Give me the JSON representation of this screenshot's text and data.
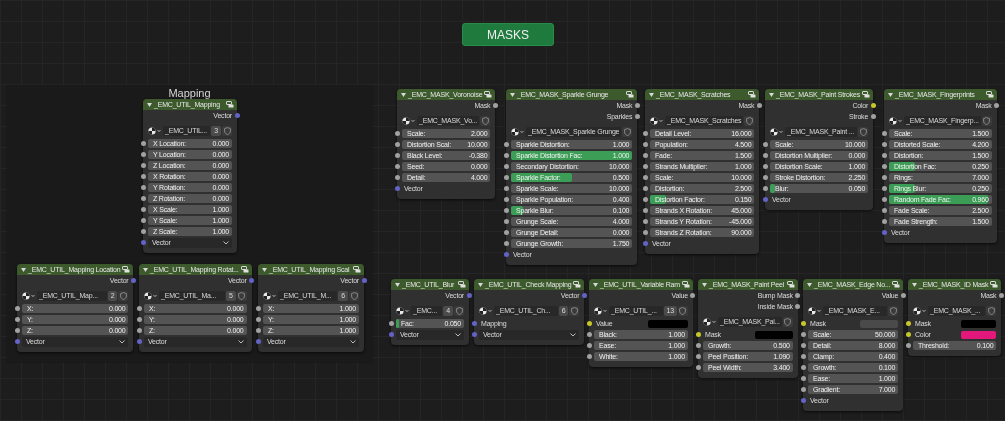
{
  "header_button": {
    "label": "MASKS"
  },
  "frames": [
    {
      "label": "Mapping",
      "nodes": [
        {
          "title": "_EMC_UTIL_Mapping",
          "outputs": [
            {
              "label": "Vector",
              "color": "#6363c7"
            }
          ],
          "datablock": {
            "name": "_EMC_UTIL...",
            "users": "3"
          },
          "inputs": [
            {
              "kind": "field",
              "label": "X Location:",
              "value": "0.000",
              "color": "#a1a1a1"
            },
            {
              "kind": "field",
              "label": "Y Location:",
              "value": "0.000",
              "color": "#a1a1a1"
            },
            {
              "kind": "field",
              "label": "Z Location:",
              "value": "0.000",
              "color": "#a1a1a1"
            },
            {
              "kind": "field",
              "label": "X Rotation:",
              "value": "0.000",
              "color": "#a1a1a1"
            },
            {
              "kind": "field",
              "label": "Y Rotation:",
              "value": "0.000",
              "color": "#a1a1a1"
            },
            {
              "kind": "field",
              "label": "Z Rotation:",
              "value": "0.000",
              "color": "#a1a1a1"
            },
            {
              "kind": "field",
              "label": "X Scale:",
              "value": "1.000",
              "color": "#a1a1a1"
            },
            {
              "kind": "field",
              "label": "Y Scale:",
              "value": "1.000",
              "color": "#a1a1a1"
            },
            {
              "kind": "field",
              "label": "Z Scale:",
              "value": "1.000",
              "color": "#a1a1a1"
            },
            {
              "kind": "dropdown",
              "label": "Vector",
              "color": "#6363c7"
            }
          ]
        },
        {
          "title": "_EMC_UTIL_Mapping Location",
          "outputs": [
            {
              "label": "Vector",
              "color": "#6363c7"
            }
          ],
          "datablock": {
            "name": "_EMC_UTIL_Map...",
            "users": "2"
          },
          "inputs": [
            {
              "kind": "field",
              "label": "X:",
              "value": "0.000",
              "color": "#a1a1a1"
            },
            {
              "kind": "field",
              "label": "Y:",
              "value": "0.000",
              "color": "#a1a1a1"
            },
            {
              "kind": "field",
              "label": "Z:",
              "value": "0.000",
              "color": "#a1a1a1"
            },
            {
              "kind": "dropdown",
              "label": "Vector",
              "color": "#6363c7"
            }
          ]
        },
        {
          "title": "_EMC_UTIL_Mapping Rotat...",
          "outputs": [
            {
              "label": "Vector",
              "color": "#6363c7"
            }
          ],
          "datablock": {
            "name": "_EMC_UTIL_Ma...",
            "users": "5"
          },
          "inputs": [
            {
              "kind": "field",
              "label": "X:",
              "value": "0.000",
              "color": "#a1a1a1"
            },
            {
              "kind": "field",
              "label": "Y:",
              "value": "0.000",
              "color": "#a1a1a1"
            },
            {
              "kind": "field",
              "label": "Z:",
              "value": "0.000",
              "color": "#a1a1a1"
            },
            {
              "kind": "dropdown",
              "label": "Vector",
              "color": "#6363c7"
            }
          ]
        },
        {
          "title": "_EMC_UTIL_Mapping Scal",
          "outputs": [
            {
              "label": "Vector",
              "color": "#6363c7"
            }
          ],
          "datablock": {
            "name": "_EMC_UTIL_M...",
            "users": "6"
          },
          "inputs": [
            {
              "kind": "field",
              "label": "X:",
              "value": "1.000",
              "color": "#a1a1a1"
            },
            {
              "kind": "field",
              "label": "Y:",
              "value": "1.000",
              "color": "#a1a1a1"
            },
            {
              "kind": "field",
              "label": "Z:",
              "value": "1.000",
              "color": "#a1a1a1"
            },
            {
              "kind": "dropdown",
              "label": "Vector",
              "color": "#6363c7"
            }
          ]
        }
      ]
    }
  ],
  "nodes": [
    {
      "title": "_EMC_MASK_Voronoise",
      "outputs": [
        {
          "label": "Mask",
          "color": "#a1a1a1"
        }
      ],
      "datablock": {
        "name": "_EMC_MASK_Vo..."
      },
      "inputs": [
        {
          "kind": "field",
          "label": "Scale:",
          "value": "2.000",
          "color": "#a1a1a1"
        },
        {
          "kind": "field",
          "label": "Distortion Scal:",
          "value": "10.000",
          "color": "#a1a1a1"
        },
        {
          "kind": "field",
          "label": "Black Level:",
          "value": "-0.380",
          "color": "#a1a1a1"
        },
        {
          "kind": "field",
          "label": "Seed:",
          "value": "0.000",
          "color": "#a1a1a1"
        },
        {
          "kind": "field",
          "label": "Detail:",
          "value": "4.000",
          "color": "#a1a1a1"
        },
        {
          "kind": "socket",
          "label": "Vector",
          "color": "#6363c7"
        }
      ]
    },
    {
      "title": "_EMC_MASK_Sparkle Grunge",
      "outputs": [
        {
          "label": "Mask",
          "color": "#a1a1a1"
        },
        {
          "label": "Sparkles",
          "color": "#a1a1a1"
        }
      ],
      "datablock": {
        "name": "_EMC_MASK_Sparkle Grunge"
      },
      "inputs": [
        {
          "kind": "field",
          "label": "Sparkle Distortion:",
          "value": "1.000",
          "color": "#a1a1a1"
        },
        {
          "kind": "slider",
          "label": "Sparkle Distortion Fac:",
          "value": "1.000",
          "level": 1,
          "color": "#a1a1a1"
        },
        {
          "kind": "field",
          "label": "Secondary Distortion:",
          "value": "10.000",
          "color": "#a1a1a1"
        },
        {
          "kind": "slider",
          "label": "Sparkle Factor:",
          "value": "0.500",
          "level": 0.5,
          "color": "#a1a1a1"
        },
        {
          "kind": "field",
          "label": "Sparkle Scale:",
          "value": "10.000",
          "color": "#a1a1a1"
        },
        {
          "kind": "field",
          "label": "Sparkle Population:",
          "value": "0.400",
          "color": "#a1a1a1"
        },
        {
          "kind": "slider",
          "label": "Sparkle Blur:",
          "value": "0.100",
          "level": 0.1,
          "color": "#a1a1a1"
        },
        {
          "kind": "field",
          "label": "Grunge Scale:",
          "value": "4.000",
          "color": "#a1a1a1"
        },
        {
          "kind": "field",
          "label": "Grunge Detail:",
          "value": "0.000",
          "color": "#a1a1a1"
        },
        {
          "kind": "field",
          "label": "Grunge Growth:",
          "value": "1.750",
          "color": "#a1a1a1"
        },
        {
          "kind": "socket",
          "label": "Vector",
          "color": "#6363c7"
        }
      ]
    },
    {
      "title": "_EMC_MASK_Scratches",
      "outputs": [
        {
          "label": "Mask",
          "color": "#a1a1a1"
        }
      ],
      "datablock": {
        "name": "_EMC_MASK_Scratches"
      },
      "inputs": [
        {
          "kind": "field",
          "label": "Detail Level:",
          "value": "16.000",
          "color": "#a1a1a1"
        },
        {
          "kind": "field",
          "label": "Population:",
          "value": "4.500",
          "color": "#a1a1a1"
        },
        {
          "kind": "field",
          "label": "Fade:",
          "value": "1.500",
          "color": "#a1a1a1"
        },
        {
          "kind": "field",
          "label": "Strands Multiplier:",
          "value": "1.000",
          "color": "#a1a1a1"
        },
        {
          "kind": "field",
          "label": "Scale:",
          "value": "10.000",
          "color": "#a1a1a1"
        },
        {
          "kind": "field",
          "label": "Distortion:",
          "value": "2.500",
          "color": "#a1a1a1"
        },
        {
          "kind": "slider",
          "label": "Distortion Factor:",
          "value": "0.150",
          "level": 0.15,
          "color": "#a1a1a1"
        },
        {
          "kind": "field",
          "label": "Strands X Rotation:",
          "value": "45.000",
          "color": "#a1a1a1"
        },
        {
          "kind": "field",
          "label": "Strands Y Rotation:",
          "value": "-45.000",
          "color": "#a1a1a1"
        },
        {
          "kind": "field",
          "label": "Strands Z Rotation:",
          "value": "90.000",
          "color": "#a1a1a1"
        },
        {
          "kind": "socket",
          "label": "Vector",
          "color": "#6363c7"
        }
      ]
    },
    {
      "title": "_EMC_MASK_Paint Strokes",
      "outputs": [
        {
          "label": "Color",
          "color": "#c7c729"
        },
        {
          "label": "Stroke",
          "color": "#a1a1a1"
        }
      ],
      "datablock": {
        "name": "_EMC_MASK_Paint ..."
      },
      "inputs": [
        {
          "kind": "field",
          "label": "Scale:",
          "value": "10.000",
          "color": "#a1a1a1"
        },
        {
          "kind": "field",
          "label": "Distortion Multiplier:",
          "value": "0.000",
          "color": "#a1a1a1"
        },
        {
          "kind": "field",
          "label": "Distortion Scale:",
          "value": "1.000",
          "color": "#a1a1a1"
        },
        {
          "kind": "field",
          "label": "Stroke Distortion:",
          "value": "2.250",
          "color": "#a1a1a1"
        },
        {
          "kind": "slider",
          "label": "Blur:",
          "value": "0.050",
          "level": 0.05,
          "color": "#a1a1a1"
        },
        {
          "kind": "socket",
          "label": "Vector",
          "color": "#6363c7"
        }
      ]
    },
    {
      "title": "_EMC_MASK_Fingerprints",
      "outputs": [
        {
          "label": "Mask",
          "color": "#a1a1a1"
        }
      ],
      "datablock": {
        "name": "_EMC_MASK_Fingerp..."
      },
      "inputs": [
        {
          "kind": "field",
          "label": "Scale:",
          "value": "1.500",
          "color": "#a1a1a1"
        },
        {
          "kind": "field",
          "label": "Distorted Scale:",
          "value": "4.200",
          "color": "#a1a1a1"
        },
        {
          "kind": "field",
          "label": "Distortion:",
          "value": "1.500",
          "color": "#a1a1a1"
        },
        {
          "kind": "slider",
          "label": "Distortion Fac:",
          "value": "0.250",
          "level": 0.25,
          "color": "#a1a1a1"
        },
        {
          "kind": "field",
          "label": "Rings:",
          "value": "7.000",
          "color": "#a1a1a1"
        },
        {
          "kind": "slider",
          "label": "Rings Blur:",
          "value": "0.250",
          "level": 0.25,
          "color": "#a1a1a1"
        },
        {
          "kind": "slider",
          "label": "Random Fade Fac:",
          "value": "0.960",
          "level": 0.96,
          "color": "#a1a1a1"
        },
        {
          "kind": "field",
          "label": "Fade Scale:",
          "value": "2.500",
          "color": "#a1a1a1"
        },
        {
          "kind": "field",
          "label": "Fade Strength:",
          "value": "1.500",
          "color": "#a1a1a1"
        },
        {
          "kind": "socket",
          "label": "Vector",
          "color": "#6363c7"
        }
      ]
    },
    {
      "title": "_EMC_UTIL_Blur",
      "outputs": [
        {
          "label": "Vector",
          "color": "#6363c7"
        }
      ],
      "datablock": {
        "name": "_EMC...",
        "users": "4"
      },
      "inputs": [
        {
          "kind": "slider",
          "label": "Fac:",
          "value": "0.050",
          "level": 0.05,
          "color": "#a1a1a1"
        },
        {
          "kind": "dropdown",
          "label": "Vector",
          "color": "#6363c7"
        }
      ]
    },
    {
      "title": "_EMC_UTIL_Check Mapping",
      "outputs": [
        {
          "label": "Vector",
          "color": "#6363c7"
        }
      ],
      "datablock": {
        "name": "_EMC_UTIL_Ch...",
        "users": "6"
      },
      "inputs": [
        {
          "kind": "socket",
          "label": "Mapping",
          "color": "#6363c7"
        },
        {
          "kind": "dropdown",
          "label": "Vector",
          "color": "#6363c7"
        }
      ]
    },
    {
      "title": "_EMC_UTIL_Variable Ram",
      "outputs": [
        {
          "label": "Value",
          "color": "#a1a1a1"
        }
      ],
      "datablock": {
        "name": "_EMC_UTIL_...",
        "users": "13"
      },
      "inputs": [
        {
          "kind": "color",
          "label": "Value",
          "swatch": {
            "color": "#000000"
          },
          "color": "#c7c729"
        },
        {
          "kind": "field",
          "label": "Black:",
          "value": "1.000",
          "color": "#a1a1a1"
        },
        {
          "kind": "field",
          "label": "Ease:",
          "value": "1.000",
          "color": "#a1a1a1"
        },
        {
          "kind": "field",
          "label": "White:",
          "value": "1.000",
          "color": "#a1a1a1"
        }
      ]
    },
    {
      "title": "_EMC_MASK_Paint Peel",
      "outputs": [
        {
          "label": "Bump Mask",
          "color": "#a1a1a1"
        },
        {
          "label": "Inside Mask",
          "color": "#a1a1a1"
        }
      ],
      "datablock": {
        "name": "_EMC_MASK_Pai..."
      },
      "inputs": [
        {
          "kind": "color",
          "label": "Mask",
          "swatch": {
            "color": "#000000"
          },
          "color": "#c7c729"
        },
        {
          "kind": "field",
          "label": "Growth:",
          "value": "0.500",
          "color": "#a1a1a1"
        },
        {
          "kind": "field",
          "label": "Peel Position:",
          "value": "1.090",
          "color": "#a1a1a1"
        },
        {
          "kind": "field",
          "label": "Peel Width:",
          "value": "3.400",
          "color": "#a1a1a1"
        }
      ]
    },
    {
      "title": "_EMC_MASK_Edge No...",
      "outputs": [
        {
          "label": "Value",
          "color": "#a1a1a1"
        }
      ],
      "datablock": {
        "name": "_EMC_MASK_E..."
      },
      "inputs": [
        {
          "kind": "color",
          "label": "Mask",
          "swatch": {
            "color": "#4a4a4a"
          },
          "color": "#c7c729"
        },
        {
          "kind": "field",
          "label": "Scale:",
          "value": "50.000",
          "color": "#a1a1a1"
        },
        {
          "kind": "field",
          "label": "Detail:",
          "value": "8.000",
          "color": "#a1a1a1"
        },
        {
          "kind": "field",
          "label": "Clamp:",
          "value": "0.400",
          "color": "#a1a1a1"
        },
        {
          "kind": "field",
          "label": "Growth:",
          "value": "0.100",
          "color": "#a1a1a1"
        },
        {
          "kind": "field",
          "label": "Ease:",
          "value": "1.000",
          "color": "#a1a1a1"
        },
        {
          "kind": "field",
          "label": "Gradient:",
          "value": "7.000",
          "color": "#a1a1a1"
        },
        {
          "kind": "socket",
          "label": "Vector",
          "color": "#6363c7"
        }
      ]
    },
    {
      "title": "_EMC_MASK_ID Mask",
      "outputs": [
        {
          "label": "Mask",
          "color": "#a1a1a1"
        }
      ],
      "datablock": {
        "name": "_EMC_MASK_..."
      },
      "inputs": [
        {
          "kind": "color",
          "label": "Mask",
          "swatch": {
            "color": "#000000"
          },
          "color": "#c7c729"
        },
        {
          "kind": "color",
          "label": "Color",
          "swatch": {
            "color": "#e3177c"
          },
          "color": "#c7c729"
        },
        {
          "kind": "field",
          "label": "Threshold:",
          "value": "0.100",
          "color": "#a1a1a1"
        }
      ]
    }
  ]
}
